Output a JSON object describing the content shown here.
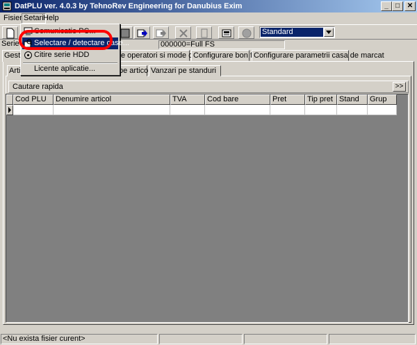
{
  "window": {
    "title": "DatPLU ver. 4.0.3 by TehnoRev Engineering for Danubius Exim",
    "icon": "app-icon",
    "controls": {
      "minimize": "_",
      "maximize": "□",
      "close": "✕"
    }
  },
  "menubar": {
    "fisier": "Fisier",
    "setari": "Setari",
    "help": "Help"
  },
  "dropdown": {
    "items": [
      {
        "label": "Comunicatie PC...",
        "icon": "pc-icon"
      },
      {
        "label": "Selectare / detectare case...",
        "icon": "search-register-icon"
      },
      {
        "label": "Citire serie HDD",
        "icon": "disk-icon"
      },
      {
        "label": "Licente aplicatie...",
        "icon": ""
      }
    ]
  },
  "toolbar": {
    "combo_value": "Standard",
    "buttons": [
      "new-icon",
      "open-icon",
      "save-icon",
      "print-icon",
      "copy-icon",
      "paste-icon",
      "import-icon",
      "export-icon",
      "delete-icon",
      "edit-icon",
      "cash-register-icon",
      "smp-icon"
    ]
  },
  "serie": {
    "label": "Serie E",
    "value": "000000=Full FS"
  },
  "tabs_top": [
    {
      "label": "Gesti"
    },
    {
      "label": "e operatori si mode de lucru"
    },
    {
      "label": "Configurare bon fiscal"
    },
    {
      "label": "Configurare parametrii casa de marcat"
    }
  ],
  "tabs_sub": [
    {
      "label": "Artic"
    },
    {
      "label": "pe articole"
    },
    {
      "label": "Vanzari pe standuri"
    }
  ],
  "cautare": {
    "label": "Cautare rapida",
    "expand": ">>"
  },
  "grid": {
    "columns": [
      "Cod PLU",
      "Denumire articol",
      "TVA",
      "Cod bare",
      "Pret",
      "Tip pret",
      "Stand",
      "Grup"
    ]
  },
  "status": {
    "text": "<Nu exista fisier curent>"
  },
  "colors": {
    "title_start": "#0a246a",
    "title_end": "#a6caf0",
    "highlight": "#0a246a",
    "annotation": "#ff0000"
  }
}
